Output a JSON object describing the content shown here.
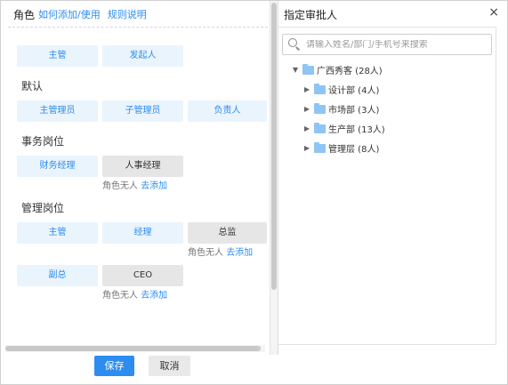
{
  "left": {
    "title": "角色",
    "links": [
      "如何添加/使用",
      "规则说明"
    ],
    "top_chips": [
      "主管",
      "发起人"
    ],
    "sections": [
      {
        "title": "默认",
        "chips": [
          "主管理员",
          "子管理员",
          "负责人"
        ]
      },
      {
        "title": "事务岗位",
        "chips": [
          "财务经理",
          "人事经理"
        ]
      },
      {
        "title": "管理岗位",
        "chips": [
          "主管",
          "经理",
          "总监",
          "副总",
          "CEO"
        ]
      }
    ],
    "hint_text": "角色无人",
    "hint_link": "去添加"
  },
  "right": {
    "title": "指定审批人",
    "close": "×",
    "search_placeholder": "请输入姓名/部门/手机号来搜索",
    "tree": {
      "root": "广西秀客 (28人)",
      "children": [
        "设计部 (4人)",
        "市场部 (3人)",
        "生产部 (13人)",
        "管理层 (8人)"
      ]
    }
  },
  "footer": {
    "save": "保存",
    "cancel": "取消"
  },
  "colors": {
    "accent": "#2d8cf0",
    "chip_bg": "#eaf4fd",
    "empty_chip_bg": "#e6e6e6",
    "folder": "#8ec5f5"
  }
}
